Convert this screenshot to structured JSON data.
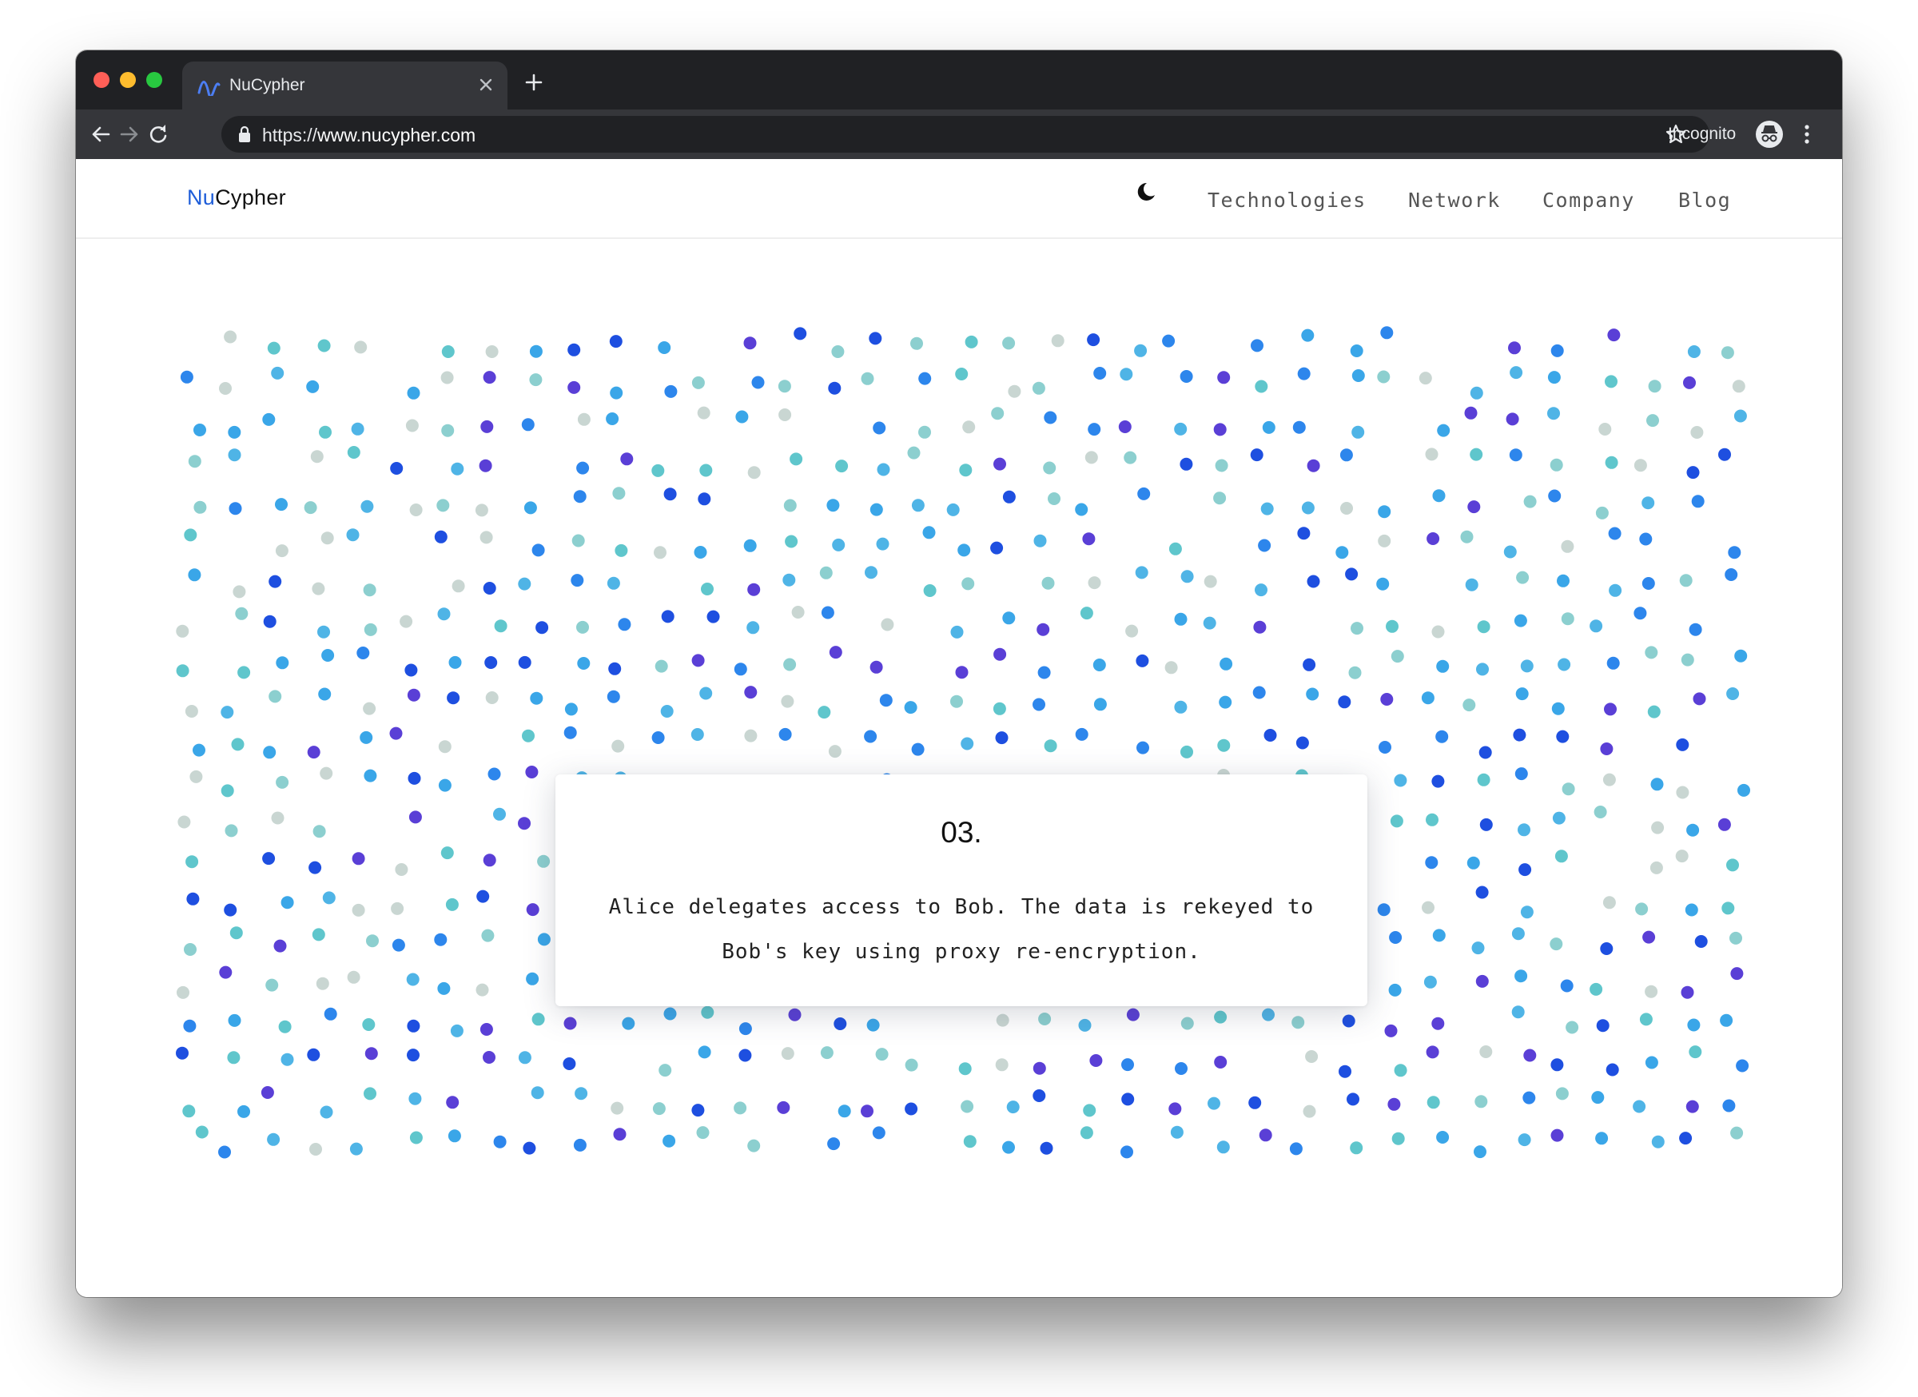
{
  "browser": {
    "tab": {
      "title": "NuCypher"
    },
    "url": {
      "scheme": "https://",
      "host": "www.nucypher.com"
    },
    "incognito_label": "Incognito"
  },
  "site": {
    "logo": {
      "prefix": "Nu",
      "suffix": "Cypher"
    },
    "nav": [
      "Technologies",
      "Network",
      "Company",
      "Blog"
    ],
    "card": {
      "number": "03.",
      "text": "Alice delegates access to Bob. The data is rekeyed to Bob's key using proxy re-encryption."
    },
    "dot_colors": [
      "#4fb4e6",
      "#2d86ec",
      "#1e4fe0",
      "#5a3fd6",
      "#8ccfcf",
      "#c9d6d2",
      "#5fc6cc",
      "#3aa6e8"
    ]
  }
}
